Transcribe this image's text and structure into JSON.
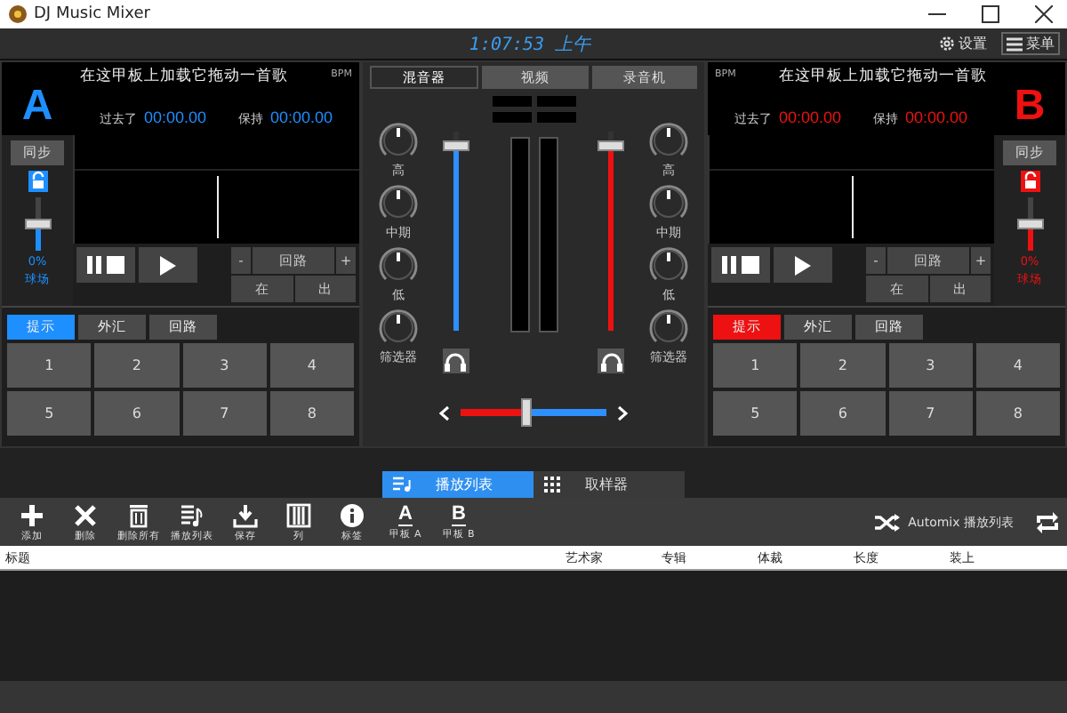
{
  "window": {
    "title": "DJ Music Mixer"
  },
  "top_bar": {
    "clock": "1:07:53 上午",
    "settings": "设置",
    "menu": "菜单"
  },
  "decks": [
    {
      "letter": "A",
      "color": "#1e8fff",
      "title": "在这甲板上加载它拖动一首歌",
      "bpm_label": "BPM",
      "elapsed_label": "过去了",
      "elapsed": "00:00.00",
      "remain_label": "保持",
      "remain": "00:00.00",
      "sync": "同步",
      "locked": false,
      "pitch": {
        "level": 0.5,
        "reading": "0%",
        "label": "球场"
      },
      "transport": {
        "minus": "-",
        "loop": "回路",
        "plus": "+",
        "in": "在",
        "out": "出"
      },
      "cue_tabs": [
        {
          "label": "提示",
          "selected": true
        },
        {
          "label": "外汇",
          "selected": false
        },
        {
          "label": "回路",
          "selected": false
        }
      ],
      "pads": [
        "1",
        "2",
        "3",
        "4",
        "5",
        "6",
        "7",
        "8"
      ]
    },
    {
      "letter": "B",
      "color": "#ee1111",
      "title": "在这甲板上加载它拖动一首歌",
      "bpm_label": "BPM",
      "elapsed_label": "过去了",
      "elapsed": "00:00.00",
      "remain_label": "保持",
      "remain": "00:00.00",
      "sync": "同步",
      "locked": false,
      "pitch": {
        "level": 0.5,
        "reading": "0%",
        "label": "球场"
      },
      "transport": {
        "minus": "-",
        "loop": "回路",
        "plus": "+",
        "in": "在",
        "out": "出"
      },
      "cue_tabs": [
        {
          "label": "提示",
          "selected": true
        },
        {
          "label": "外汇",
          "selected": false
        },
        {
          "label": "回路",
          "selected": false
        }
      ],
      "pads": [
        "1",
        "2",
        "3",
        "4",
        "5",
        "6",
        "7",
        "8"
      ]
    }
  ],
  "mixer": {
    "tabs": [
      {
        "label": "混音器",
        "selected": true
      },
      {
        "label": "视频",
        "selected": false
      },
      {
        "label": "录音机",
        "selected": false
      }
    ],
    "channels": [
      {
        "knobs": [
          "高",
          "中期",
          "低",
          "筛选器"
        ],
        "fader": {
          "level": 0.95
        }
      },
      {
        "knobs": [
          "高",
          "中期",
          "低",
          "筛选器"
        ],
        "fader": {
          "level": 0.95
        }
      }
    ],
    "crossfader": {
      "level": 0.45
    }
  },
  "bottom_tabs": [
    {
      "label": "播放列表",
      "selected": true,
      "kind": "playlist"
    },
    {
      "label": "取样器",
      "selected": false,
      "kind": "sampler"
    }
  ],
  "toolbar": [
    {
      "kind": "plus",
      "label": "添加"
    },
    {
      "kind": "cross",
      "label": "删除"
    },
    {
      "kind": "trash",
      "label": "删除所有"
    },
    {
      "kind": "playlist",
      "label": "播放列表"
    },
    {
      "kind": "save",
      "label": "保存"
    },
    {
      "kind": "columns",
      "label": "列"
    },
    {
      "kind": "info",
      "label": "标签"
    },
    {
      "kind": "letter",
      "glyph": "A",
      "label": "甲板 A"
    },
    {
      "kind": "letter",
      "glyph": "B",
      "label": "甲板 B"
    }
  ],
  "automix": {
    "label": "Automix 播放列表"
  },
  "table": {
    "columns": [
      "标题",
      "艺术家",
      "专辑",
      "体裁",
      "长度",
      "装上"
    ]
  }
}
